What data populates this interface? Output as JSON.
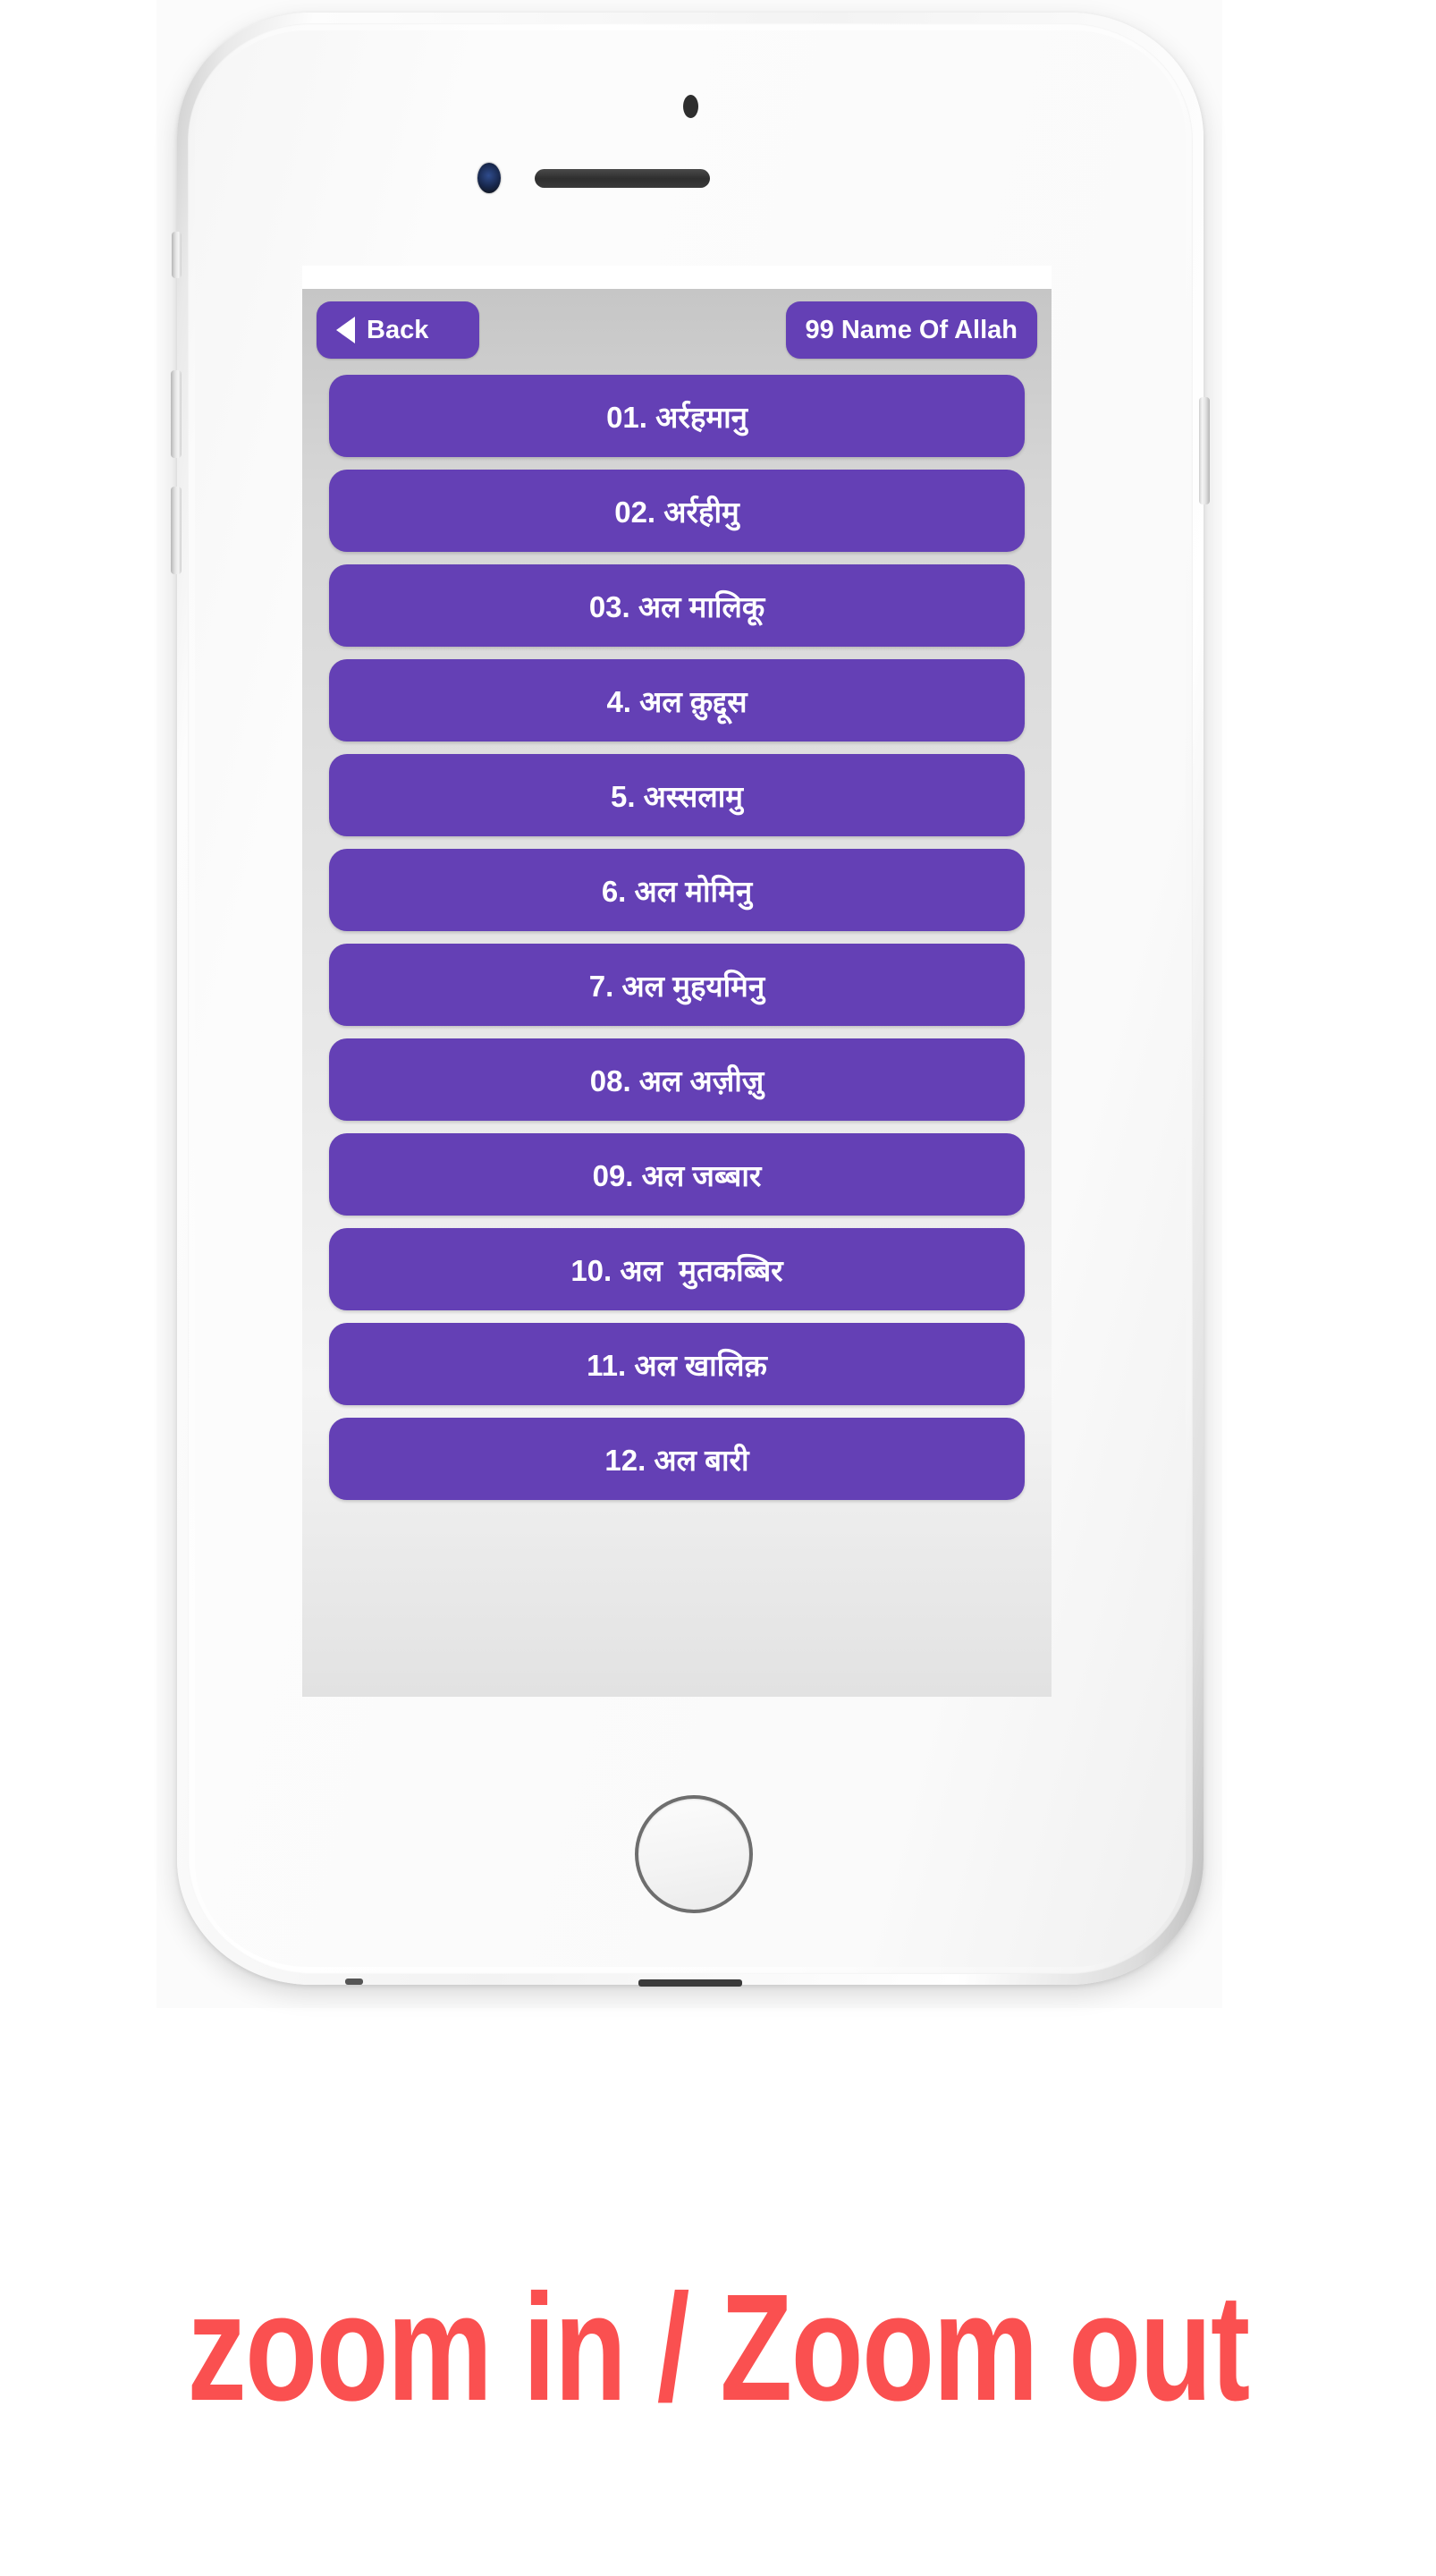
{
  "caption": {
    "text": "zoom in / Zoom out",
    "color": "#fa5050"
  },
  "device": {
    "type": "white-smartphone",
    "icons": {
      "sensor": "proximity-sensor-icon",
      "camera": "front-camera-icon",
      "earpiece": "earpiece-speaker-icon",
      "home": "home-button-icon"
    }
  },
  "app": {
    "accent_color": "#6440b5",
    "background_color": "#e4e4e4",
    "topbar": {
      "back_label": "Back",
      "title": "99 Name Of Allah"
    },
    "list": [
      {
        "label": "01. अर्रहमानु"
      },
      {
        "label": "02. अर्रहीमु"
      },
      {
        "label": "03. अल मालिकू"
      },
      {
        "label": "4. अल क़ुद्दूस"
      },
      {
        "label": "5. अस्सलामु"
      },
      {
        "label": "6. अल मोमिनु"
      },
      {
        "label": "7. अल मुहयमिनु"
      },
      {
        "label": "08. अल अज़ीज़ु"
      },
      {
        "label": "09. अल जब्बार"
      },
      {
        "label": "10. अल  मुतकब्बिर"
      },
      {
        "label": "11. अल खालिक़"
      },
      {
        "label": "12. अल बारी"
      }
    ]
  }
}
